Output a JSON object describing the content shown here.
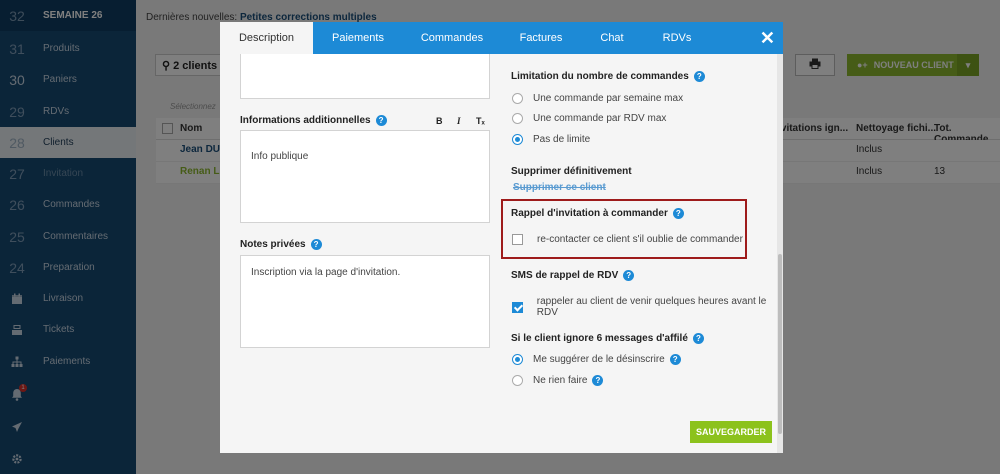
{
  "sidebar": {
    "items": [
      {
        "num": "32",
        "label": "SEMAINE 26"
      },
      {
        "num": "31",
        "label": "Produits"
      },
      {
        "num": "30",
        "label": "Paniers"
      },
      {
        "num": "29",
        "label": "RDVs"
      },
      {
        "num": "28",
        "label": "Clients"
      },
      {
        "num": "27",
        "label": "Invitation"
      },
      {
        "num": "26",
        "label": "Commandes"
      },
      {
        "num": "25",
        "label": "Commentaires"
      },
      {
        "num": "24",
        "label": "Preparation"
      },
      {
        "num": "",
        "label": "Livraison",
        "icon": "calendar-icon"
      },
      {
        "num": "",
        "label": "Tickets",
        "icon": "cash-register-icon"
      },
      {
        "num": "",
        "label": "Paiements",
        "icon": "sitemap-icon"
      }
    ],
    "bottom_icons": [
      "bell-icon",
      "paper-plane-icon",
      "gear-icon"
    ],
    "bell_badge": "1"
  },
  "topbar": {
    "news_prefix": "Dernières nouvelles:",
    "news_link": "Petites corrections multiples"
  },
  "background": {
    "search_label": "2 clients",
    "selection_hint": "Sélectionnez",
    "col_name": "Nom",
    "col_invitations": "Invitations ign...",
    "col_nettoyage": "Nettoyage fichi...",
    "col_total": "Tot. Commande",
    "row1_name": "Jean DUPO",
    "row1_nettoyage": "Inclus",
    "row2_name": "Renan LE",
    "row2_nettoyage": "Inclus",
    "row2_total": "13",
    "new_client_label": "NOUVEAU CLIENT"
  },
  "modal": {
    "tabs": [
      "Description",
      "Paiements",
      "Commandes",
      "Factures",
      "Chat",
      "RDVs"
    ],
    "close": "✕",
    "additional_info_label": "Informations additionnelles",
    "additional_info_value": "Info publique",
    "format_bold": "B",
    "format_italic": "I",
    "format_clear": "Tₓ",
    "private_notes_label": "Notes privées",
    "private_notes_value": "Inscription via la page d'invitation.",
    "order_limit_label": "Limitation du nombre de commandes",
    "order_limit_options": [
      "Une commande par semaine max",
      "Une commande par RDV max",
      "Pas de limite"
    ],
    "order_limit_selected": 2,
    "delete_label": "Supprimer définitivement",
    "delete_link": "Supprimer ce client",
    "invite_reminder_label": "Rappel d'invitation à commander",
    "invite_reminder_checkbox": "re-contacter ce client s'il oublie de commander",
    "invite_reminder_checked": false,
    "sms_label": "SMS de rappel de RDV",
    "sms_checkbox": "rappeler au client de venir quelques heures avant le RDV",
    "sms_checked": true,
    "ignore_label": "Si le client ignore 6 messages d'affilé",
    "ignore_options": [
      "Me suggérer de le désinscrire",
      "Ne rien faire"
    ],
    "ignore_selected": 0,
    "save_label": "SAUVEGARDER"
  },
  "colors": {
    "sidebar": "#174a73",
    "tab_bar": "#1d8ad6",
    "save_button": "#8cc21c",
    "highlight_border": "#9e1b1b"
  }
}
